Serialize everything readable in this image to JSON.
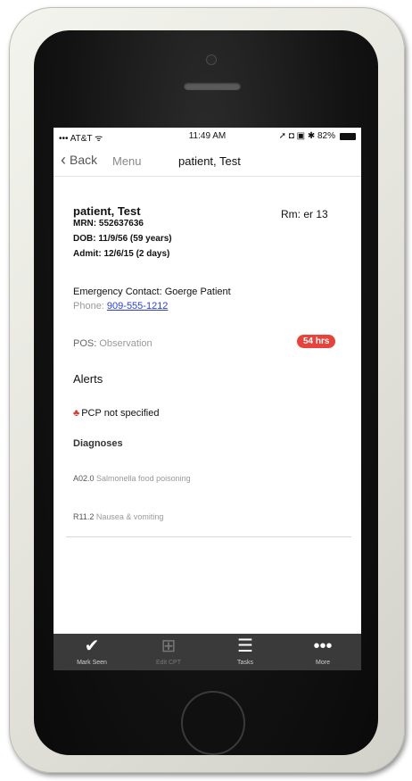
{
  "status_bar": {
    "carrier": "••• AT&T ᯤ",
    "time": "11:49 AM",
    "right_icons": "➚ ◘ ▣ ✱ 82%"
  },
  "nav": {
    "back_label": "Back",
    "menu_label": "Menu",
    "title": "patient, Test"
  },
  "patient": {
    "name": "patient, Test",
    "room": "Rm: er 13",
    "mrn": "MRN: 552637636",
    "dob": "DOB: 11/9/56 (59 years)",
    "admit": "Admit: 12/6/15 (2 days)",
    "emergency_contact": "Emergency Contact: Goerge Patient",
    "phone_label": "Phone: ",
    "phone_number": "909-555-1212"
  },
  "pos": {
    "label": "POS: ",
    "value": "Observation",
    "hours_badge": "54 hrs"
  },
  "alerts": {
    "title": "Alerts",
    "items": [
      {
        "icon": "person-alert-icon",
        "text": "PCP not specified"
      }
    ]
  },
  "diagnoses": {
    "title": "Diagnoses",
    "items": [
      {
        "code": "A02.0",
        "text": " Salmonella food poisoning"
      },
      {
        "code": "R11.2",
        "text": " Nausea & vomiting"
      }
    ]
  },
  "tab_bar": [
    {
      "label": "Mark Seen",
      "icon": "checkmark-icon",
      "glyph": "✔"
    },
    {
      "label": "Edit CPT",
      "icon": "medical-kit-icon",
      "glyph": "⊞"
    },
    {
      "label": "Tasks",
      "icon": "list-icon",
      "glyph": "☰"
    },
    {
      "label": "More",
      "icon": "more-icon",
      "glyph": "•••"
    }
  ],
  "colors": {
    "badge": "#e8423b",
    "link": "#2a3fd8",
    "alert_icon": "#d43a33",
    "tab_bar": "#3a3a3a"
  }
}
